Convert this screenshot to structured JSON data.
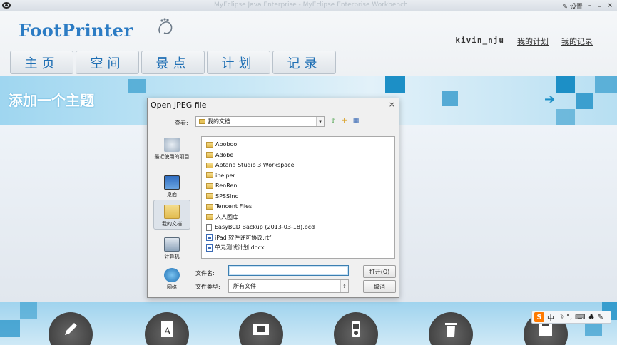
{
  "window": {
    "ghost_title": "MyEclipse Java Enterprise - MyEclipse Enterprise Workbench",
    "settings_label": "设置"
  },
  "header": {
    "logo_text": "FootPrinter",
    "user_name": "kivin_nju",
    "links": [
      "我的计划",
      "我的记录"
    ]
  },
  "nav": {
    "tabs": [
      "主页",
      "空间",
      "景点",
      "计划",
      "记录"
    ]
  },
  "banner": {
    "title": "添加一个主题"
  },
  "dialog": {
    "title": "Open JPEG file",
    "close": "×",
    "look_in_label": "查看:",
    "look_in_value": "我的文档",
    "places": [
      {
        "label": "最近使用的项目",
        "icon": "recent-items-icon"
      },
      {
        "label": "桌面",
        "icon": "desktop-icon"
      },
      {
        "label": "我的文档",
        "icon": "my-documents-icon",
        "selected": true
      },
      {
        "label": "计算机",
        "icon": "computer-icon"
      },
      {
        "label": "网络",
        "icon": "network-icon"
      }
    ],
    "files": [
      {
        "name": "Aboboo",
        "type": "folder"
      },
      {
        "name": "Adobe",
        "type": "folder"
      },
      {
        "name": "Aptana Studio 3 Workspace",
        "type": "folder"
      },
      {
        "name": "ihelper",
        "type": "folder"
      },
      {
        "name": "RenRen",
        "type": "folder"
      },
      {
        "name": "SPSSInc",
        "type": "folder"
      },
      {
        "name": "Tencent Files",
        "type": "folder"
      },
      {
        "name": "人人图库",
        "type": "folder"
      },
      {
        "name": "EasyBCD Backup (2013-03-18).bcd",
        "type": "file"
      },
      {
        "name": "iPad 软件许可协议.rtf",
        "type": "word"
      },
      {
        "name": "单元测试计划.docx",
        "type": "word"
      }
    ],
    "filename_label": "文件名:",
    "filename_value": "",
    "filetype_label": "文件类型:",
    "filetype_value": "所有文件",
    "open_button": "打开(O)",
    "cancel_button": "取消"
  },
  "ime": {
    "logo": "S",
    "mode": "中"
  },
  "colors": {
    "brand_blue": "#2c7cc4",
    "banner_blue": "#1c8fc6"
  }
}
